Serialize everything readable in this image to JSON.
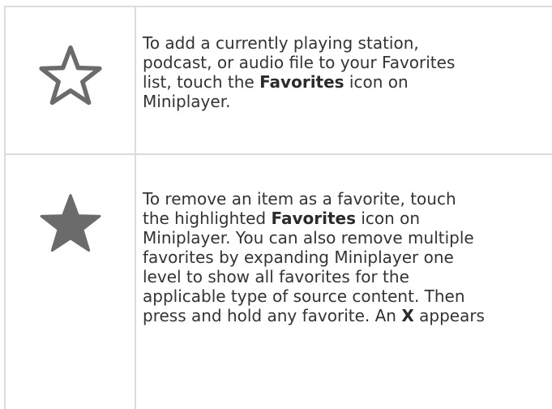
{
  "rows": [
    {
      "icon": "star-outline-icon",
      "lines": [
        {
          "text": "To add a currently playing station,"
        },
        {
          "text": "podcast, or audio file to your Favorites"
        },
        {
          "pre": "list, touch the ",
          "bold": "Favorites",
          "post": " icon on"
        },
        {
          "text": "Miniplayer."
        }
      ]
    },
    {
      "icon": "star-filled-icon",
      "lines": [
        {
          "text": "To remove an item as a favorite, touch"
        },
        {
          "pre": "the highlighted ",
          "bold": "Favorites",
          "post": " icon on"
        },
        {
          "text": "Miniplayer. You can also remove multiple"
        },
        {
          "text": "favorites by expanding Miniplayer one"
        },
        {
          "text": "level to show all favorites for the"
        },
        {
          "text": "applicable type of source content. Then"
        },
        {
          "pre": "press and hold any favorite. An ",
          "bold": "X",
          "post": " appears"
        }
      ]
    }
  ],
  "colors": {
    "grid": "#dcdcdc",
    "icon": "#6b6b6b",
    "text": "#333333"
  }
}
